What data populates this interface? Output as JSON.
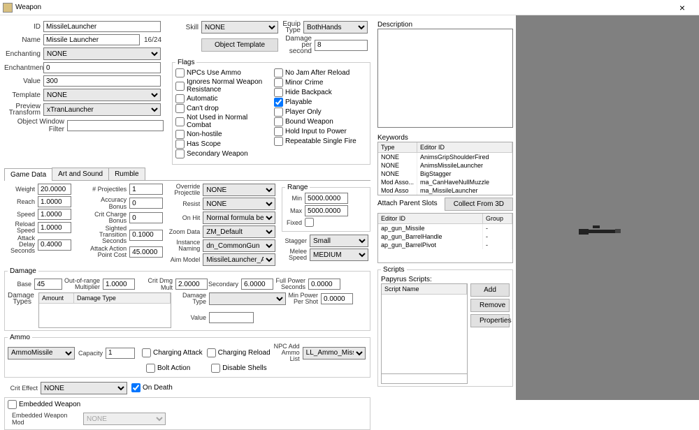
{
  "window": {
    "title": "Weapon",
    "close": "×"
  },
  "header": {
    "id_label": "ID",
    "id_value": "MissileLauncher",
    "name_label": "Name",
    "name_value": "Missile Launcher",
    "name_count": "16/24",
    "enchanting_label": "Enchanting",
    "enchanting_value": "NONE",
    "enchantment_label": "Enchantment",
    "enchantment_value": "0",
    "value_label": "Value",
    "value_value": "300",
    "template_label": "Template",
    "template_value": "NONE",
    "preview_transform_label": "Preview Transform",
    "preview_transform_value": "xTranLauncher",
    "owf_label": "Object Window Filter",
    "owf_value": "",
    "skill_label": "Skill",
    "skill_value": "NONE",
    "equip_type_label": "Equip Type",
    "equip_type_value": "BothHands",
    "object_template_btn": "Object Template",
    "dps_label": "Damage per second",
    "dps_value": "8"
  },
  "flags": {
    "legend": "Flags",
    "col1": [
      {
        "label": "NPCs Use Ammo",
        "checked": false
      },
      {
        "label": "Ignores Normal Weapon Resistance",
        "checked": false
      },
      {
        "label": "Automatic",
        "checked": false
      },
      {
        "label": "Can't drop",
        "checked": false
      },
      {
        "label": "Not Used in Normal Combat",
        "checked": false
      },
      {
        "label": "Non-hostile",
        "checked": false
      },
      {
        "label": "Has Scope",
        "checked": false
      },
      {
        "label": "Secondary Weapon",
        "checked": false
      }
    ],
    "col2": [
      {
        "label": "No Jam After Reload",
        "checked": false
      },
      {
        "label": "Minor Crime",
        "checked": false
      },
      {
        "label": "Hide Backpack",
        "checked": false
      },
      {
        "label": "Playable",
        "checked": true
      },
      {
        "label": "Player Only",
        "checked": false
      },
      {
        "label": "Bound Weapon",
        "checked": false
      },
      {
        "label": "Hold Input to Power",
        "checked": false
      },
      {
        "label": "Repeatable Single Fire",
        "checked": false
      }
    ]
  },
  "tabs": [
    "Game Data",
    "Art and Sound",
    "Rumble"
  ],
  "gamedata": {
    "weight_label": "Weight",
    "weight": "20.0000",
    "reach_label": "Reach",
    "reach": "1.0000",
    "speed_label": "Speed",
    "speed": "1.0000",
    "reload_speed_label": "Reload Speed",
    "reload_speed": "1.0000",
    "attack_delay_label": "Attack Delay Seconds",
    "attack_delay": "0.4000",
    "projectiles_label": "# Projectiles",
    "projectiles": "1",
    "accuracy_label": "Accuracy Bonus",
    "accuracy": "0",
    "crit_charge_label": "Crit Charge Bonus",
    "crit_charge": "0",
    "sighted_trans_label": "Sighted Transition Seconds",
    "sighted_trans": "0.1000",
    "attack_ap_label": "Attack Action Point Cost",
    "attack_ap": "45.0000",
    "override_proj_label": "Override Projectile",
    "override_proj": "NONE",
    "resist_label": "Resist",
    "resist": "NONE",
    "onhit_label": "On Hit",
    "onhit": "Normal formula behavior",
    "zoom_label": "Zoom Data",
    "zoom": "ZM_Default",
    "instance_label": "Instance Naming",
    "instance": "dn_CommonGun",
    "aim_model_label": "Aim Model",
    "aim_model": "MissileLauncher_AM",
    "range_legend": "Range",
    "range_min_label": "Min",
    "range_min": "5000.0000",
    "range_max_label": "Max",
    "range_max": "5000.0000",
    "range_fixed_label": "Fixed",
    "stagger_label": "Stagger",
    "stagger": "Small",
    "melee_speed_label": "Melee Speed",
    "melee_speed": "MEDIUM"
  },
  "damage": {
    "legend": "Damage",
    "base_label": "Base",
    "base": "45",
    "oor_label": "Out-of-range Multiplier",
    "oor": "1.0000",
    "crit_mult_label": "Crit Dmg Mult",
    "crit_mult": "2.0000",
    "secondary_label": "Secondary",
    "secondary": "6.0000",
    "full_power_label": "Full Power Seconds",
    "full_power": "0.0000",
    "types_label": "Damage Types",
    "table_headers": [
      "Amount",
      "Damage Type"
    ],
    "damage_type_label": "Damage Type",
    "damage_type": "",
    "min_power_label": "Min Power Per Shot",
    "min_power": "0.0000",
    "value_label": "Value",
    "value": ""
  },
  "ammo": {
    "legend": "Ammo",
    "ammo_value": "AmmoMissile",
    "capacity_label": "Capacity",
    "capacity": "1",
    "charging_attack": "Charging Attack",
    "bolt_action": "Bolt Action",
    "charging_reload": "Charging Reload",
    "disable_shells": "Disable Shells",
    "npc_add_label": "NPC Add Ammo List",
    "npc_add": "LL_Ammo_Missile"
  },
  "crit": {
    "effect_label": "Crit Effect",
    "effect": "NONE",
    "on_death": "On Death",
    "embedded_label": "Embedded Weapon",
    "embedded_mod_label": "Embedded Weapon Mod",
    "embedded_mod": "NONE"
  },
  "desc": {
    "label": "Description",
    "value": ""
  },
  "keywords": {
    "label": "Keywords",
    "headers": [
      "Type",
      "Editor ID"
    ],
    "rows": [
      {
        "type": "NONE",
        "id": "AnimsGripShoulderFired"
      },
      {
        "type": "NONE",
        "id": "AnimsMissileLauncher"
      },
      {
        "type": "NONE",
        "id": "BigStagger"
      },
      {
        "type": "Mod Asso...",
        "id": "ma_CanHaveNullMuzzle"
      },
      {
        "type": "Mod Asso",
        "id": "ma_MissileLauncher"
      }
    ]
  },
  "attach": {
    "label": "Attach Parent Slots",
    "collect_btn": "Collect From 3D",
    "headers": [
      "Editor ID",
      "Group"
    ],
    "rows": [
      {
        "id": "ap_gun_Missile",
        "group": "-"
      },
      {
        "id": "ap_gun_BarrelHandle",
        "group": "-"
      },
      {
        "id": "ap_gun_BarrelPivot",
        "group": "-"
      }
    ]
  },
  "scripts": {
    "legend": "Scripts",
    "papyrus_label": "Papyrus Scripts:",
    "header": "Script Name",
    "add": "Add",
    "remove": "Remove",
    "properties": "Properties"
  }
}
